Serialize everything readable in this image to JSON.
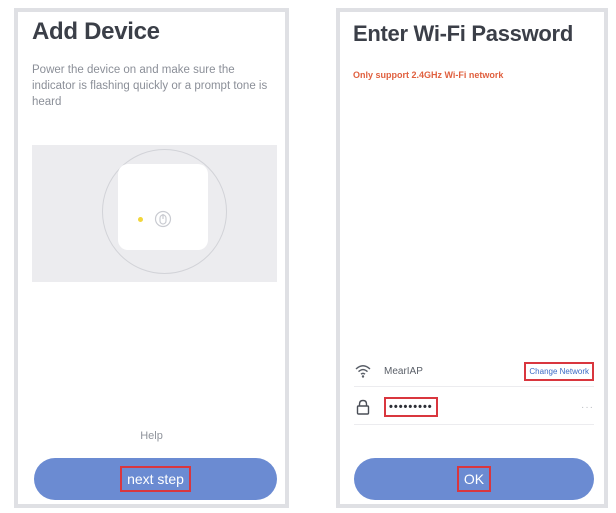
{
  "add_device": {
    "title": "Add Device",
    "description": "Power the device on and make sure the indicator is flashing quickly or a prompt tone is heard",
    "illustration_icon": "power-button-icon",
    "help_label": "Help",
    "next_label": "next step"
  },
  "wifi": {
    "title": "Enter Wi-Fi Password",
    "note": "Only support 2.4GHz Wi-Fi network",
    "ssid_icon": "wifi-icon",
    "ssid": "MearIAP",
    "change_label": "Change Network",
    "password_icon": "lock-icon",
    "password_masked": "•••••••••",
    "visibility_toggle": "···",
    "ok_label": "OK"
  },
  "colors": {
    "accent": "#6b8bd2",
    "highlight": "#d9363e",
    "warning": "#e0603f",
    "link": "#3a69c4"
  }
}
